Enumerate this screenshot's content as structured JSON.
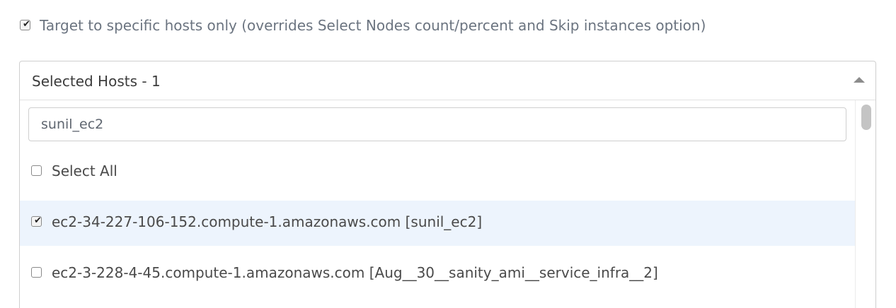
{
  "target_option": {
    "checked": true,
    "label": "Target to specific hosts only (overrides Select Nodes count/percent and Skip instances option)"
  },
  "host_select": {
    "header_label": "Selected Hosts - 1",
    "search_value": "sunil_ec2",
    "select_all_label": "Select All",
    "select_all_checked": false,
    "options": [
      {
        "label": "ec2-34-227-106-152.compute-1.amazonaws.com [sunil_ec2]",
        "checked": true,
        "highlighted": true
      },
      {
        "label": "ec2-3-228-4-45.compute-1.amazonaws.com [Aug__30__sanity_ami__service_infra__2]",
        "checked": false,
        "highlighted": false
      }
    ]
  },
  "colors": {
    "highlight_row": "#edf4fd",
    "text": "#4a4a4a",
    "muted_text": "#6b7480",
    "border": "#cfcfcf"
  }
}
